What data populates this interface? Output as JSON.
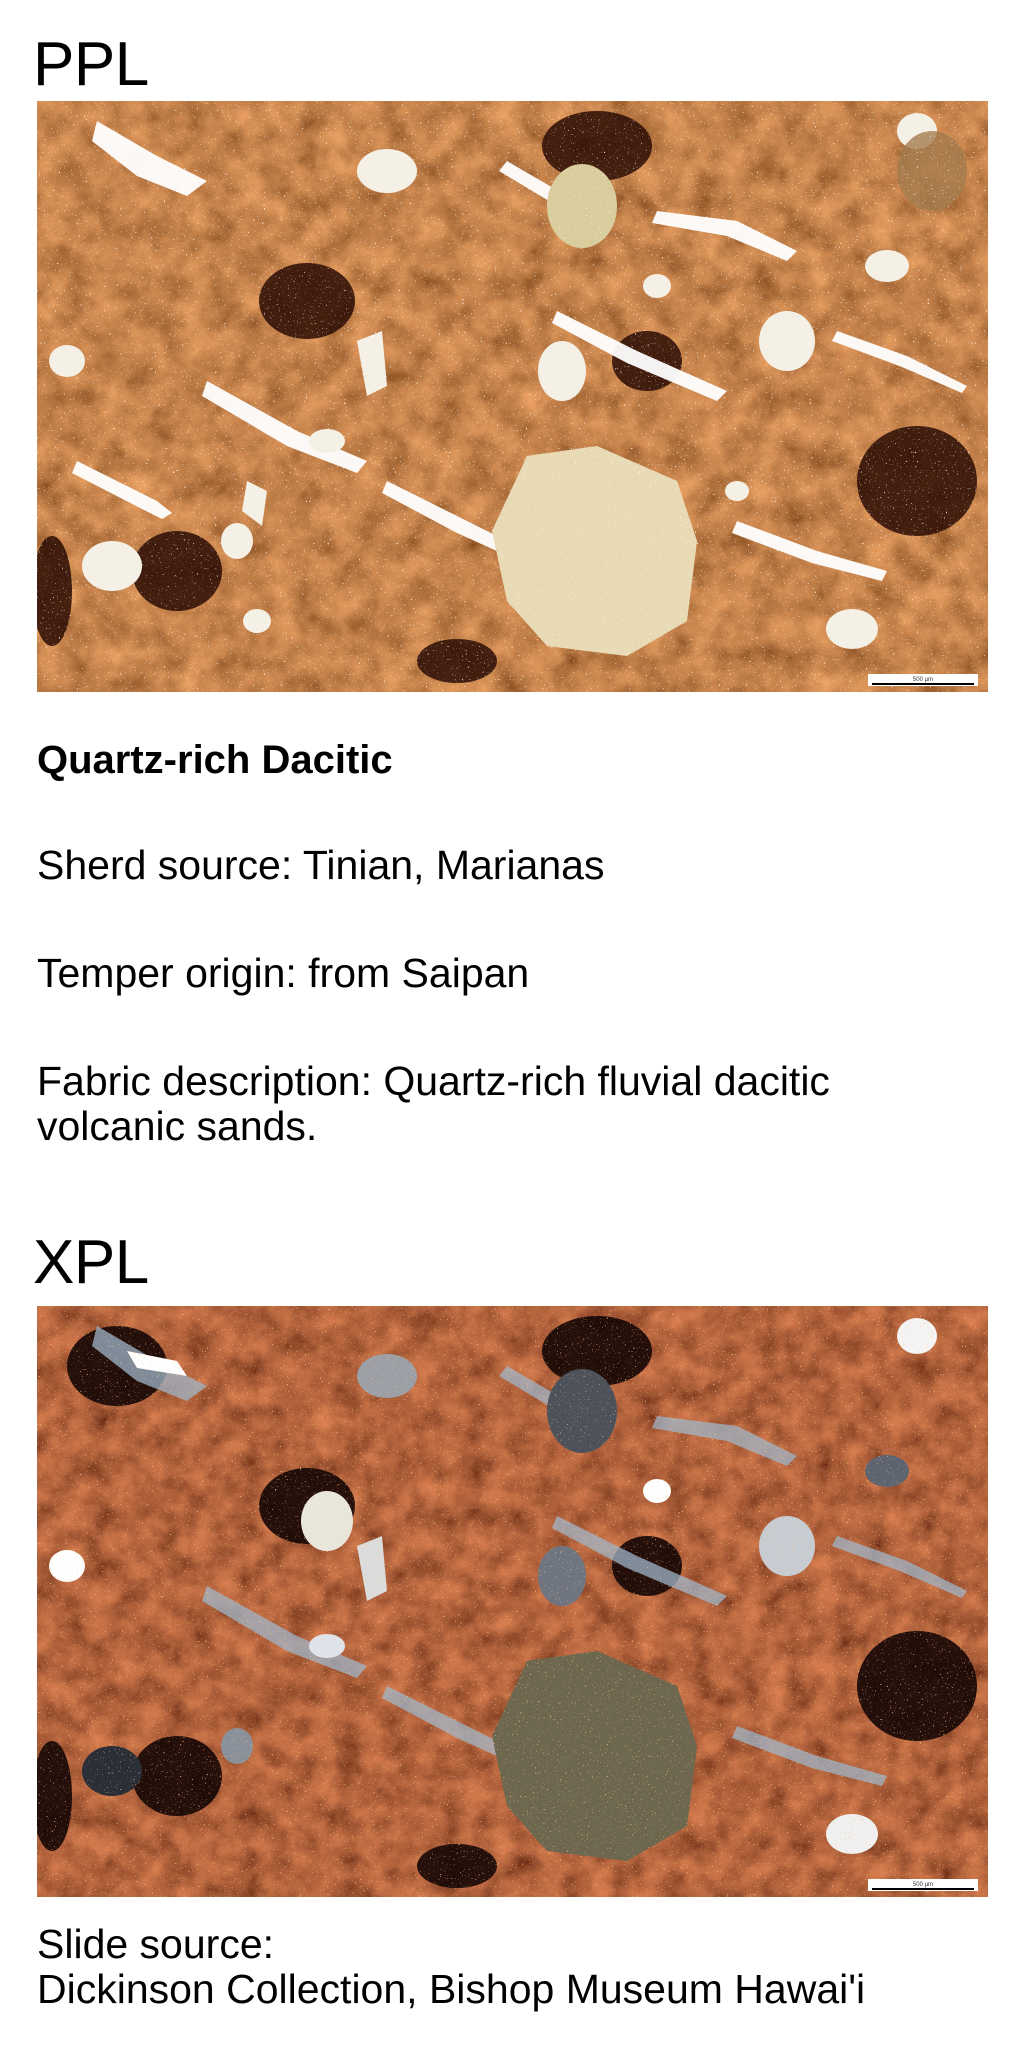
{
  "ppl": {
    "title": "PPL",
    "scale_label": "500 µm"
  },
  "fabric": {
    "name": "Quartz-rich Dacitic",
    "sherd_source": "Sherd source: Tinian, Marianas",
    "temper_origin": "Temper origin: from Saipan",
    "description": "Fabric description: Quartz-rich fluvial dacitic\nvolcanic sands."
  },
  "xpl": {
    "title": "XPL",
    "scale_label": "500 µm"
  },
  "slide": {
    "source": "Slide source:\nDickinson Collection, Bishop Museum Hawai'i"
  },
  "colors": {
    "ppl_matrix": "#7a3a12",
    "ppl_dark": "#2a0c05",
    "xpl_matrix": "#5a1f0c",
    "xpl_dark": "#140604",
    "grain_light": "#f4f0e6",
    "void_blue": "#9fb6c9"
  }
}
